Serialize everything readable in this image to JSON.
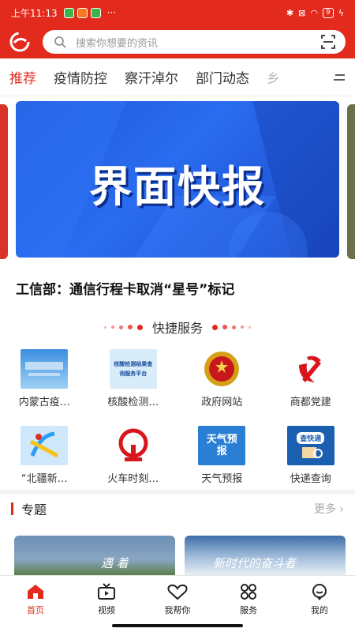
{
  "status_bar": {
    "time": "上午11:13",
    "more": "···",
    "battery": "9"
  },
  "header": {
    "search_placeholder": "搜索你想要的资讯"
  },
  "tabs": [
    {
      "label": "推荐",
      "active": true
    },
    {
      "label": "疫情防控"
    },
    {
      "label": "察汗淖尔"
    },
    {
      "label": "部门动态"
    },
    {
      "label": "乡"
    }
  ],
  "banner": {
    "image_text": "界面快报",
    "headline": "工信部：通信行程卡取消“星号”标记"
  },
  "quick_services": {
    "title": "快捷服务",
    "items": [
      {
        "label": "内蒙古疫…",
        "icon": "covid-info-icon"
      },
      {
        "label": "核酸检测…",
        "icon": "nucleic-test-icon",
        "icon_text": "核酸检测结果查询服务平台"
      },
      {
        "label": "政府网站",
        "icon": "national-emblem-icon"
      },
      {
        "label": "商都党建",
        "icon": "party-emblem-icon"
      },
      {
        "label": "“北疆新…",
        "icon": "beijiang-logo-icon"
      },
      {
        "label": "火车时刻…",
        "icon": "railway-logo-icon"
      },
      {
        "label": "天气预报",
        "icon": "weather-icon",
        "icon_text": "天气预报"
      },
      {
        "label": "快递查询",
        "icon": "express-icon",
        "icon_text": "查快递"
      }
    ]
  },
  "topics": {
    "title": "专题",
    "more": "更多",
    "cards": [
      {
        "text": "遇 着"
      },
      {
        "text": "新时代的奋斗者"
      }
    ]
  },
  "bottom_nav": [
    {
      "label": "首页",
      "active": true
    },
    {
      "label": "视频"
    },
    {
      "label": "我帮你"
    },
    {
      "label": "服务"
    },
    {
      "label": "我的"
    }
  ],
  "colors": {
    "brand_red": "#e22b1d",
    "banner_blue": "#2a6cf0"
  }
}
